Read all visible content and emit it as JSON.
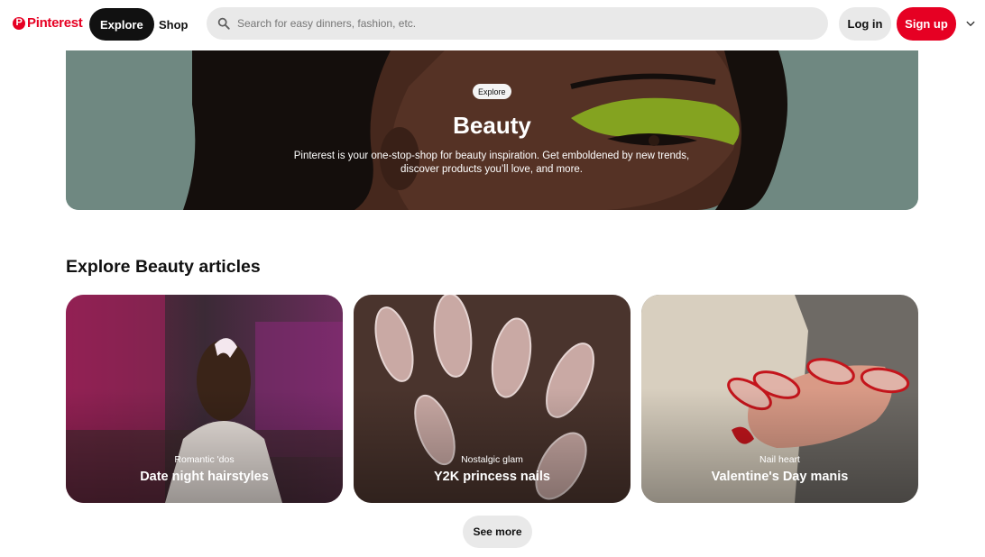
{
  "header": {
    "logo_text": "Pinterest",
    "logo_mark": "P",
    "nav_explore": "Explore",
    "nav_shop": "Shop",
    "search_placeholder": "Search for easy dinners, fashion, etc.",
    "login_label": "Log in",
    "signup_label": "Sign up",
    "icons": {
      "search": "search-icon",
      "menu": "chevron-down-icon"
    }
  },
  "hero": {
    "pill": "Explore",
    "title": "Beauty",
    "description": "Pinterest is your one-stop-shop for beauty inspiration. Get emboldened by new trends, discover products you’ll love, and more."
  },
  "section": {
    "title": "Explore Beauty articles",
    "cards": [
      {
        "subtitle": "Romantic 'dos",
        "title": "Date night hairstyles"
      },
      {
        "subtitle": "Nostalgic glam",
        "title": "Y2K princess nails"
      },
      {
        "subtitle": "Nail heart",
        "title": "Valentine's Day manis"
      }
    ],
    "see_more": "See more"
  },
  "colors": {
    "brand_red": "#e60023",
    "dark": "#111111",
    "pill_gray": "#e9e9e9",
    "hero_bg": "#8fafa6"
  }
}
